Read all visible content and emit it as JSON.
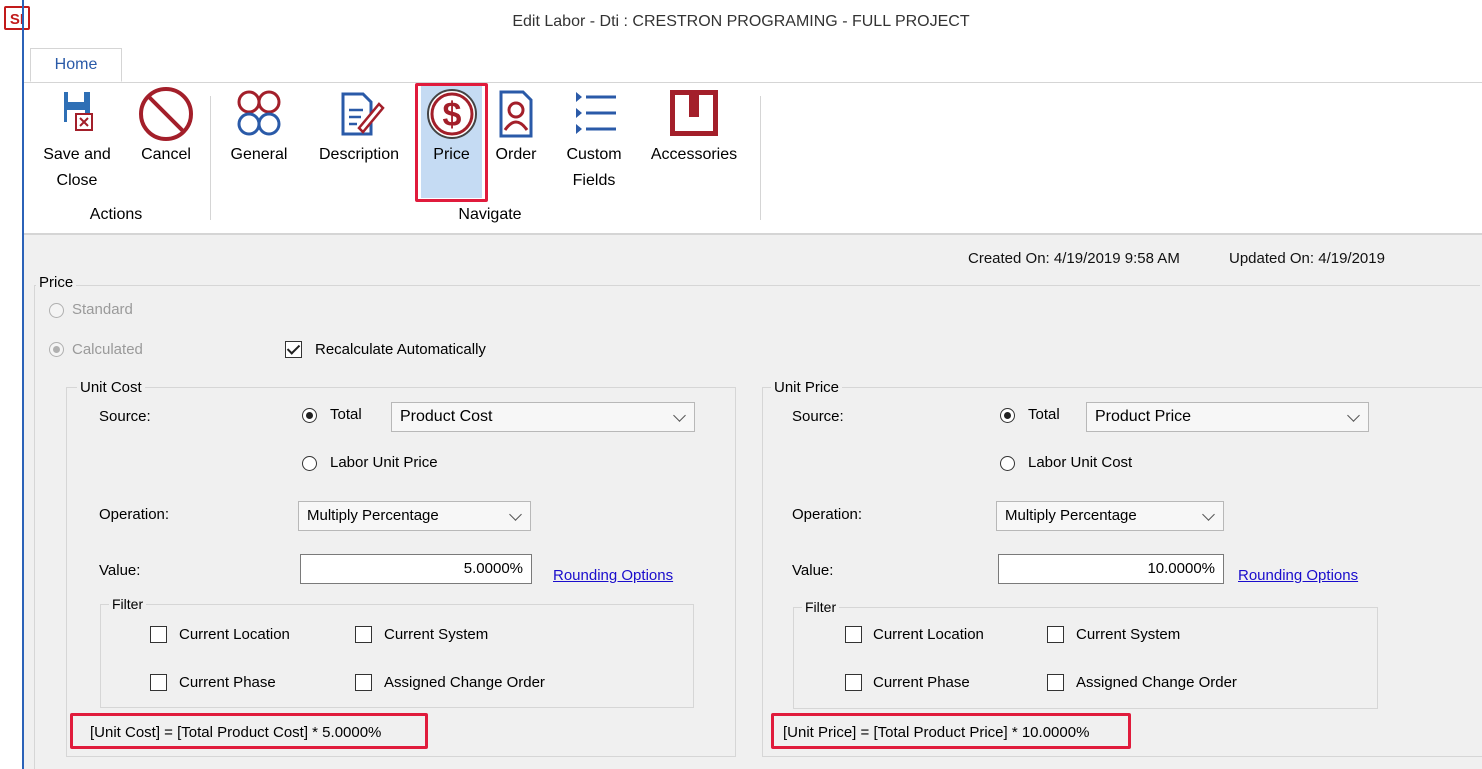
{
  "window": {
    "app_logo": "SI",
    "title": "Edit Labor - Dti : CRESTRON PROGRAMING - FULL PROJECT"
  },
  "ribbon": {
    "tab_home": "Home",
    "buttons": {
      "save_close_1": "Save and",
      "save_close_2": "Close",
      "cancel": "Cancel",
      "general": "General",
      "description": "Description",
      "price": "Price",
      "order": "Order",
      "custom_fields_1": "Custom",
      "custom_fields_2": "Fields",
      "accessories": "Accessories"
    },
    "groups": {
      "actions": "Actions",
      "navigate": "Navigate"
    },
    "colors": {
      "accent": "#2a5aa8",
      "icon_red": "#a31f2a",
      "highlight": "#e01b3c",
      "selected_bg": "#c5dbf3"
    }
  },
  "meta": {
    "created": "Created On: 4/19/2019 9:58 AM",
    "updated": "Updated On: 4/19/2019"
  },
  "price": {
    "group_label": "Price",
    "standard": "Standard",
    "calculated": "Calculated",
    "recalc": "Recalculate Automatically",
    "unit_cost": {
      "label": "Unit Cost",
      "source_label": "Source:",
      "total": "Total",
      "source_value": "Product Cost",
      "alt_option": "Labor Unit Price",
      "operation_label": "Operation:",
      "operation_value": "Multiply Percentage",
      "value_label": "Value:",
      "value": "5.0000%",
      "rounding": "Rounding Options",
      "filter_label": "Filter",
      "current_location": "Current Location",
      "current_system": "Current System",
      "current_phase": "Current Phase",
      "assigned_change_order": "Assigned Change Order",
      "formula": "[Unit Cost] = [Total Product Cost] * 5.0000%"
    },
    "unit_price": {
      "label": "Unit Price",
      "source_label": "Source:",
      "total": "Total",
      "source_value": "Product Price",
      "alt_option": "Labor Unit Cost",
      "operation_label": "Operation:",
      "operation_value": "Multiply Percentage",
      "value_label": "Value:",
      "value": "10.0000%",
      "rounding": "Rounding Options",
      "filter_label": "Filter",
      "current_location": "Current Location",
      "current_system": "Current System",
      "current_phase": "Current Phase",
      "assigned_change_order": "Assigned Change Order",
      "formula": "[Unit Price] = [Total Product Price] * 10.0000%"
    }
  }
}
